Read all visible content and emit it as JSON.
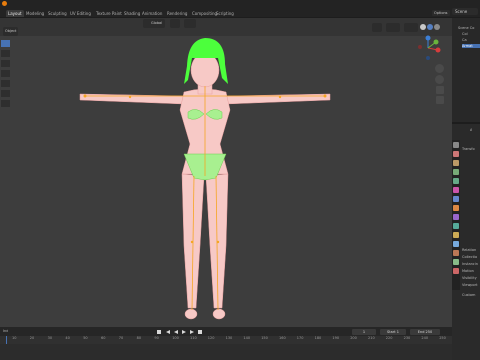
{
  "workspace_tabs": [
    "Layout",
    "Modeling",
    "Sculpting",
    "UV Editing",
    "Texture Paint",
    "Shading",
    "Animation",
    "Rendering",
    "Compositing",
    "Scripting"
  ],
  "active_tab": "Layout",
  "scene": {
    "name": "Scene",
    "options_label": "Options"
  },
  "viewport": {
    "mode_label": "Object",
    "pivot_label": "Global"
  },
  "outliner": {
    "items": [
      "Scene Co",
      "Col",
      "Ca",
      "Armat"
    ]
  },
  "properties": {
    "tab_label": "A",
    "sections": [
      "Transfo",
      "Relation",
      "Collectio",
      "Instancin",
      "Motion",
      "Visibility",
      "Viewport",
      "Custom"
    ]
  },
  "timeline": {
    "playback_label": "Ind",
    "current_frame": "1",
    "start_label": "Start",
    "start": "1",
    "end_label": "End",
    "end": "250",
    "ticks": [
      "10",
      "20",
      "30",
      "40",
      "50",
      "60",
      "70",
      "80",
      "90",
      "100",
      "110",
      "120",
      "130",
      "140",
      "150",
      "160",
      "170",
      "180",
      "190",
      "200",
      "210",
      "220",
      "230",
      "240",
      "250"
    ]
  },
  "colors": {
    "viewport_bg": "#3d3d3d",
    "skin": "#f7c9c6",
    "hair": "#4cff3c",
    "bone": "#f5a623",
    "accent": "#4772b3"
  },
  "icons": [
    "cursor-icon",
    "move-icon",
    "rotate-icon",
    "scale-icon",
    "transform-icon",
    "annotate-icon",
    "measure-icon",
    "zoom-icon",
    "hand-icon",
    "camera-icon",
    "grid-icon",
    "play-icon"
  ]
}
